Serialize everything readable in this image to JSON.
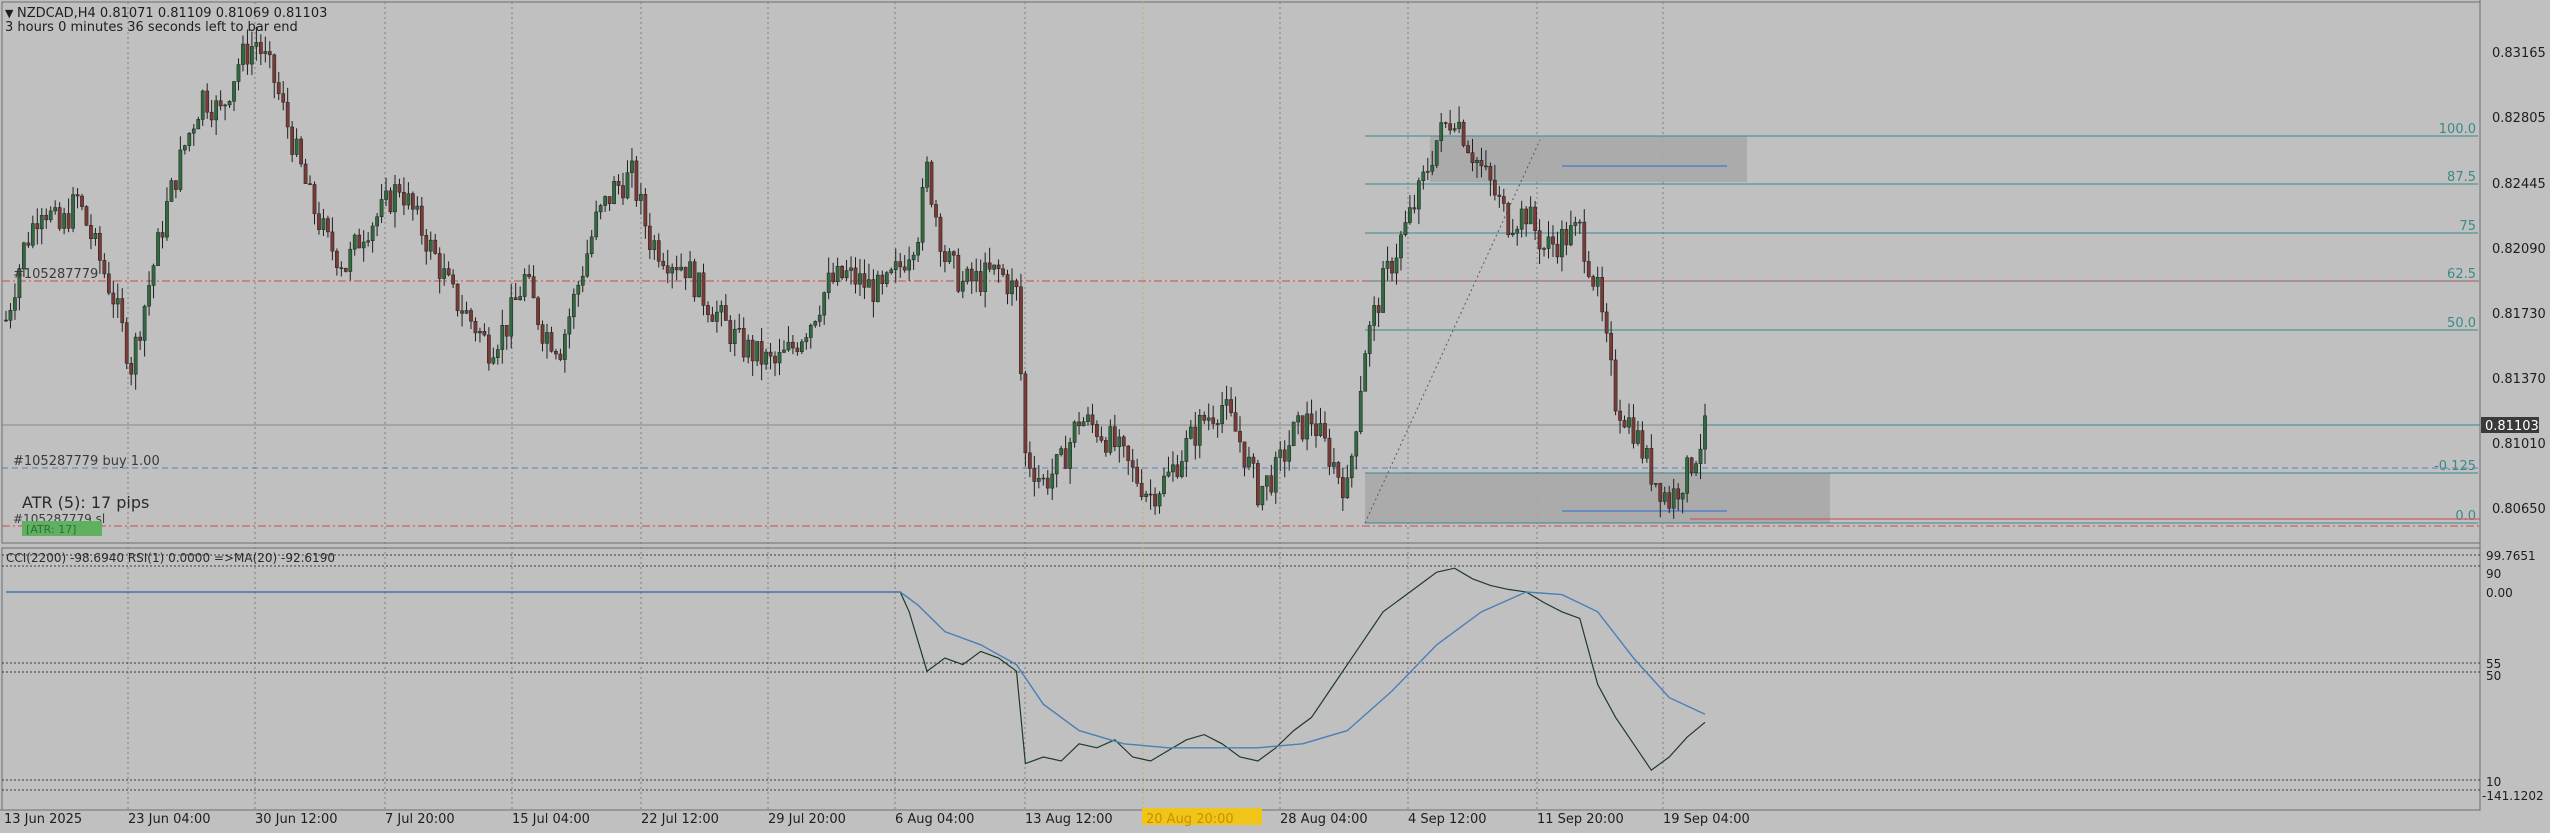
{
  "colors": {
    "background": "#c0c0c0",
    "grid": "#8a8a8a",
    "candle_up": "#2f6b3f",
    "candle_down": "#7a3b36",
    "wick": "#1e1e1e",
    "fib": "#3b8a8a",
    "trade_line_red": "#d24a4a",
    "trade_line_blue": "#5a7fc8",
    "zone": "#a9a9a9",
    "current_price_bg": "#3a3a3a",
    "current_price_text": "#ffffff",
    "indicator_line": "#1f3a2a",
    "indicator_ma": "#4a7fb8",
    "atr_bg": "#5fb15f",
    "highlight_date_bg": "#f0c419",
    "text": "#1e1e1e"
  },
  "header": {
    "symbol_line": "NZDCAD,H4  0.81071 0.81109 0.81069 0.81103",
    "countdown": "3 hours 0 minutes 36 seconds left to bar end"
  },
  "price_axis": {
    "labels": [
      "0.83165",
      "0.82805",
      "0.82445",
      "0.82090",
      "0.81730",
      "0.81370",
      "0.81010",
      "0.80650"
    ],
    "current_price": "0.81103"
  },
  "fib_levels": [
    {
      "label": "100.0",
      "price": 0.828
    },
    {
      "label": "87.5",
      "price": 0.825
    },
    {
      "label": "75",
      "price": 0.822
    },
    {
      "label": "62.5",
      "price": 0.819
    },
    {
      "label": "50.0",
      "price": 0.816
    },
    {
      "label": "-0.125",
      "price": 0.8085
    },
    {
      "label": "0.0",
      "price": 0.8055
    }
  ],
  "trade_labels": {
    "order_label": "#105287779",
    "buy_label": "#105287779 buy 1.00",
    "sl_label": "#105287779 sl"
  },
  "atr": {
    "text": "ATR (5): 17 pips",
    "badge": "[ATR: 17]"
  },
  "indicator": {
    "title": "CCI(2200) -98.6940  RSI(1) 0.0000  =>MA(20) -92.6190",
    "axis_labels": [
      "99.7651",
      "90",
      "0.00",
      "55",
      "50",
      "10",
      "-141.1202"
    ]
  },
  "time_axis": {
    "labels": [
      "13 Jun 2025",
      "23 Jun 04:00",
      "30 Jun 12:00",
      "7 Jul 20:00",
      "15 Jul 04:00",
      "22 Jul 12:00",
      "29 Jul 20:00",
      "6 Aug 04:00",
      "13 Aug 12:00",
      "20 Aug 20:00",
      "28 Aug 04:00",
      "4 Sep 12:00",
      "11 Sep 20:00",
      "19 Sep 04:00"
    ],
    "highlighted": "20 Aug 20:00"
  },
  "chart_data": {
    "type": "candlestick",
    "symbol": "NZDCAD",
    "timeframe": "H4",
    "x": [
      "13 Jun 2025",
      "23 Jun 04:00",
      "30 Jun 12:00",
      "7 Jul 20:00",
      "15 Jul 04:00",
      "22 Jul 12:00",
      "29 Jul 20:00",
      "6 Aug 04:00",
      "13 Aug 12:00",
      "20 Aug 20:00",
      "28 Aug 04:00",
      "4 Sep 12:00",
      "11 Sep 20:00",
      "19 Sep 04:00"
    ],
    "price_path": [
      [
        0,
        0.8165
      ],
      [
        4,
        0.8205
      ],
      [
        8,
        0.823
      ],
      [
        12,
        0.8215
      ],
      [
        16,
        0.8232
      ],
      [
        20,
        0.8205
      ],
      [
        24,
        0.8178
      ],
      [
        28,
        0.814
      ],
      [
        32,
        0.8185
      ],
      [
        36,
        0.8228
      ],
      [
        40,
        0.8262
      ],
      [
        44,
        0.829
      ],
      [
        48,
        0.828
      ],
      [
        52,
        0.8308
      ],
      [
        56,
        0.832
      ],
      [
        60,
        0.8298
      ],
      [
        64,
        0.8265
      ],
      [
        68,
        0.8232
      ],
      [
        72,
        0.8208
      ],
      [
        76,
        0.8195
      ],
      [
        80,
        0.8215
      ],
      [
        84,
        0.8225
      ],
      [
        88,
        0.824
      ],
      [
        92,
        0.822
      ],
      [
        96,
        0.82
      ],
      [
        100,
        0.8178
      ],
      [
        104,
        0.8165
      ],
      [
        108,
        0.815
      ],
      [
        112,
        0.8162
      ],
      [
        116,
        0.8188
      ],
      [
        120,
        0.816
      ],
      [
        124,
        0.815
      ],
      [
        128,
        0.8185
      ],
      [
        132,
        0.822
      ],
      [
        136,
        0.8238
      ],
      [
        140,
        0.8245
      ],
      [
        144,
        0.821
      ],
      [
        148,
        0.82
      ],
      [
        152,
        0.8195
      ],
      [
        156,
        0.8178
      ],
      [
        160,
        0.8165
      ],
      [
        164,
        0.8152
      ],
      [
        168,
        0.8145
      ],
      [
        172,
        0.814
      ],
      [
        176,
        0.815
      ],
      [
        180,
        0.8165
      ],
      [
        184,
        0.8185
      ],
      [
        188,
        0.819
      ],
      [
        192,
        0.8185
      ],
      [
        196,
        0.818
      ],
      [
        200,
        0.8195
      ],
      [
        204,
        0.8215
      ],
      [
        206,
        0.8248
      ],
      [
        210,
        0.82
      ],
      [
        214,
        0.8185
      ],
      [
        218,
        0.8188
      ],
      [
        222,
        0.8192
      ],
      [
        226,
        0.818
      ],
      [
        228,
        0.809
      ],
      [
        232,
        0.8075
      ],
      [
        236,
        0.8085
      ],
      [
        240,
        0.811
      ],
      [
        244,
        0.8105
      ],
      [
        248,
        0.8095
      ],
      [
        252,
        0.808
      ],
      [
        256,
        0.8068
      ],
      [
        260,
        0.8078
      ],
      [
        264,
        0.8095
      ],
      [
        268,
        0.811
      ],
      [
        272,
        0.8118
      ],
      [
        276,
        0.8098
      ],
      [
        280,
        0.807
      ],
      [
        284,
        0.808
      ],
      [
        288,
        0.8102
      ],
      [
        292,
        0.811
      ],
      [
        296,
        0.809
      ],
      [
        300,
        0.807
      ],
      [
        304,
        0.815
      ],
      [
        308,
        0.8185
      ],
      [
        312,
        0.821
      ],
      [
        316,
        0.8235
      ],
      [
        320,
        0.8265
      ],
      [
        324,
        0.828
      ],
      [
        328,
        0.8258
      ],
      [
        332,
        0.824
      ],
      [
        336,
        0.822
      ],
      [
        340,
        0.8225
      ],
      [
        344,
        0.8205
      ],
      [
        348,
        0.821
      ],
      [
        352,
        0.8215
      ],
      [
        356,
        0.818
      ],
      [
        360,
        0.812
      ],
      [
        364,
        0.8105
      ],
      [
        368,
        0.808
      ],
      [
        372,
        0.8065
      ],
      [
        376,
        0.808
      ],
      [
        380,
        0.8103
      ]
    ],
    "indicator_series": [
      {
        "name": "CCI(2200)",
        "values": [
          [
            0,
            0.0
          ],
          [
            200,
            0.0
          ],
          [
            202,
            -15
          ],
          [
            206,
            -60
          ],
          [
            210,
            -50
          ],
          [
            214,
            -55
          ],
          [
            218,
            -45
          ],
          [
            222,
            -50
          ],
          [
            226,
            -60
          ],
          [
            228,
            -130
          ],
          [
            232,
            -125
          ],
          [
            236,
            -128
          ],
          [
            240,
            -115
          ],
          [
            244,
            -118
          ],
          [
            248,
            -112
          ],
          [
            252,
            -125
          ],
          [
            256,
            -128
          ],
          [
            260,
            -120
          ],
          [
            264,
            -112
          ],
          [
            268,
            -108
          ],
          [
            272,
            -115
          ],
          [
            276,
            -125
          ],
          [
            280,
            -128
          ],
          [
            284,
            -118
          ],
          [
            288,
            -105
          ],
          [
            292,
            -95
          ],
          [
            296,
            -75
          ],
          [
            300,
            -55
          ],
          [
            304,
            -35
          ],
          [
            308,
            -15
          ],
          [
            312,
            -5
          ],
          [
            316,
            5
          ],
          [
            320,
            15
          ],
          [
            324,
            18
          ],
          [
            328,
            10
          ],
          [
            332,
            5
          ],
          [
            336,
            2
          ],
          [
            340,
            0
          ],
          [
            344,
            -8
          ],
          [
            348,
            -15
          ],
          [
            352,
            -20
          ],
          [
            356,
            -70
          ],
          [
            360,
            -95
          ],
          [
            364,
            -115
          ],
          [
            368,
            -135
          ],
          [
            372,
            -125
          ],
          [
            376,
            -110
          ],
          [
            380,
            -98.694
          ]
        ]
      },
      {
        "name": "MA(20)",
        "values": [
          [
            0,
            0.0
          ],
          [
            200,
            0.0
          ],
          [
            204,
            -10
          ],
          [
            210,
            -30
          ],
          [
            218,
            -40
          ],
          [
            226,
            -55
          ],
          [
            232,
            -85
          ],
          [
            240,
            -105
          ],
          [
            250,
            -115
          ],
          [
            260,
            -118
          ],
          [
            270,
            -118
          ],
          [
            280,
            -118
          ],
          [
            290,
            -115
          ],
          [
            300,
            -105
          ],
          [
            310,
            -75
          ],
          [
            320,
            -40
          ],
          [
            330,
            -15
          ],
          [
            340,
            0
          ],
          [
            348,
            -2
          ],
          [
            356,
            -15
          ],
          [
            364,
            -50
          ],
          [
            372,
            -80
          ],
          [
            380,
            -92.619
          ]
        ]
      }
    ],
    "ylim": [
      0.804,
      0.834
    ]
  }
}
